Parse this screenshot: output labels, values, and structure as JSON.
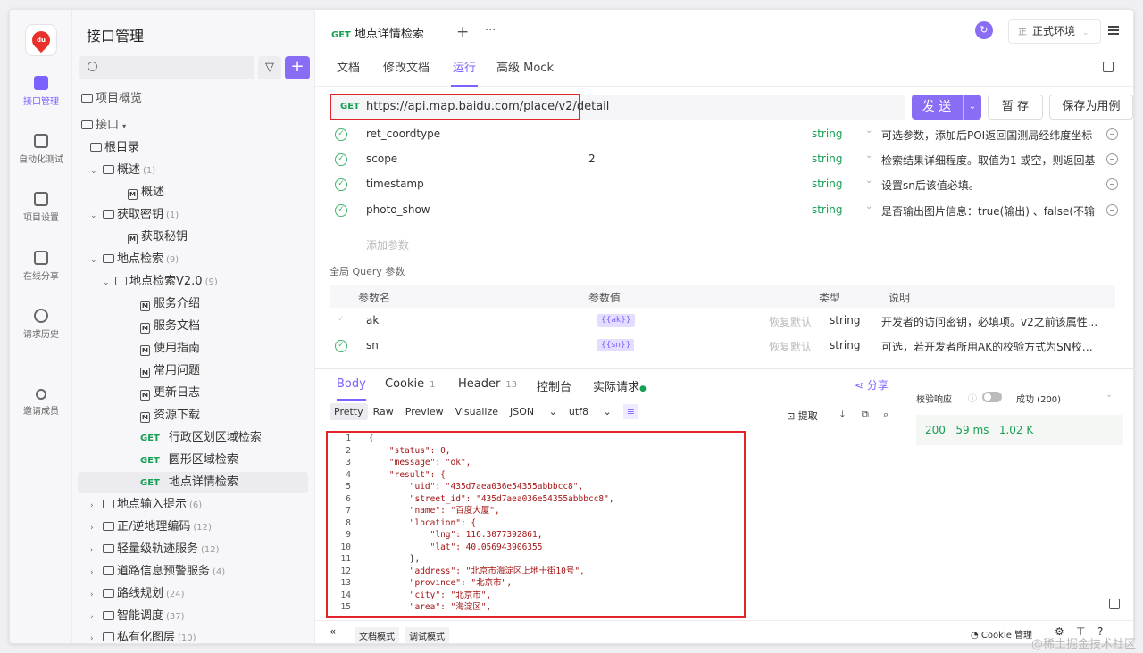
{
  "rail": {
    "items": [
      {
        "label": "接口管理",
        "icon": "api-icon"
      },
      {
        "label": "自动化测试",
        "icon": "automation-icon"
      },
      {
        "label": "项目设置",
        "icon": "settings-icon"
      },
      {
        "label": "在线分享",
        "icon": "share-doc-icon"
      },
      {
        "label": "请求历史",
        "icon": "history-icon"
      },
      {
        "label": "邀请成员",
        "icon": "invite-icon"
      }
    ],
    "logo_text": "du"
  },
  "sidebar": {
    "title": "接口管理",
    "overview": "项目概览",
    "api_root": "接口",
    "nodes": [
      {
        "label": "根目录",
        "count": ""
      },
      {
        "label": "概述",
        "count": "(1)"
      },
      {
        "label": "概述",
        "count": ""
      },
      {
        "label": "获取密钥",
        "count": "(1)"
      },
      {
        "label": "获取秘钥",
        "count": ""
      },
      {
        "label": "地点检索",
        "count": "(9)"
      },
      {
        "label": "地点检索V2.0",
        "count": "(9)"
      },
      {
        "label": "服务介绍",
        "count": ""
      },
      {
        "label": "服务文档",
        "count": ""
      },
      {
        "label": "使用指南",
        "count": ""
      },
      {
        "label": "常用问题",
        "count": ""
      },
      {
        "label": "更新日志",
        "count": ""
      },
      {
        "label": "资源下载",
        "count": ""
      },
      {
        "label": "行政区划区域检索",
        "count": "",
        "method": "GET"
      },
      {
        "label": "圆形区域检索",
        "count": "",
        "method": "GET"
      },
      {
        "label": "地点详情检索",
        "count": "",
        "method": "GET"
      },
      {
        "label": "地点输入提示",
        "count": "(6)"
      },
      {
        "label": "正/逆地理编码",
        "count": "(12)"
      },
      {
        "label": "轻量级轨迹服务",
        "count": "(12)"
      },
      {
        "label": "道路信息预警服务",
        "count": "(4)"
      },
      {
        "label": "路线规划",
        "count": "(24)"
      },
      {
        "label": "智能调度",
        "count": "(37)"
      },
      {
        "label": "私有化图层",
        "count": "(10)"
      }
    ]
  },
  "header": {
    "tab_method": "GET",
    "tab_title": "地点详情检索",
    "plus": "+",
    "more": "···",
    "env_badge": "正",
    "env": "正式环境"
  },
  "subtabs": [
    "文档",
    "修改文档",
    "运行",
    "高级 Mock"
  ],
  "url": {
    "method": "GET",
    "value": "https://api.map.baidu.com/place/v2/detail"
  },
  "buttons": {
    "send": "发 送",
    "save_temp": "暂 存",
    "save_case": "保存为用例"
  },
  "params": [
    {
      "name": "ret_coordtype",
      "value": "",
      "type": "string",
      "desc": "可选参数，添加后POI返回国测局经纬度坐标"
    },
    {
      "name": "scope",
      "value": "2",
      "type": "string",
      "desc": "检索结果详细程度。取值为1 或空，则返回基"
    },
    {
      "name": "timestamp",
      "value": "",
      "type": "string",
      "desc": "设置sn后该值必填。"
    },
    {
      "name": "photo_show",
      "value": "",
      "type": "string",
      "desc": "是否输出图片信息：true(输出) 、false(不输"
    }
  ],
  "add_param": "添加参数",
  "global_query": {
    "title": "全局 Query 参数",
    "headers": [
      "参数名",
      "参数值",
      "类型",
      "说明"
    ],
    "rows": [
      {
        "name": "ak",
        "value": "{{ak}}",
        "reset": "恢复默认",
        "type": "string",
        "desc": "开发者的访问密钥，必填项。v2之前该属性..."
      },
      {
        "name": "sn",
        "value": "{{sn}}",
        "reset": "恢复默认",
        "type": "string",
        "desc": "可选，若开发者所用AK的校验方式为SN校验..."
      }
    ]
  },
  "response": {
    "tabs": [
      {
        "label": "Body",
        "count": ""
      },
      {
        "label": "Cookie",
        "count": "1"
      },
      {
        "label": "Header",
        "count": "13"
      },
      {
        "label": "控制台",
        "count": ""
      },
      {
        "label": "实际请求",
        "count": ""
      }
    ],
    "share": "分享",
    "formats": [
      "Pretty",
      "Raw",
      "Preview",
      "Visualize"
    ],
    "format": "JSON",
    "encoding": "utf8",
    "extract": "提取",
    "validate_label": "校验响应",
    "status": "成功 (200)",
    "code": "200",
    "time": "59 ms",
    "size": "1.02 K"
  },
  "code_lines": [
    {
      "n": "1",
      "t": "{"
    },
    {
      "n": "2",
      "t": "    \"status\": 0,"
    },
    {
      "n": "3",
      "t": "    \"message\": \"ok\","
    },
    {
      "n": "4",
      "t": "    \"result\": {"
    },
    {
      "n": "5",
      "t": "        \"uid\": \"435d7aea036e54355abbbcc8\","
    },
    {
      "n": "6",
      "t": "        \"street_id\": \"435d7aea036e54355abbbcc8\","
    },
    {
      "n": "7",
      "t": "        \"name\": \"百度大厦\","
    },
    {
      "n": "8",
      "t": "        \"location\": {"
    },
    {
      "n": "9",
      "t": "            \"lng\": 116.3077392861,"
    },
    {
      "n": "10",
      "t": "            \"lat\": 40.056943906355"
    },
    {
      "n": "11",
      "t": "        },"
    },
    {
      "n": "12",
      "t": "        \"address\": \"北京市海淀区上地十街10号\","
    },
    {
      "n": "13",
      "t": "        \"province\": \"北京市\","
    },
    {
      "n": "14",
      "t": "        \"city\": \"北京市\","
    },
    {
      "n": "15",
      "t": "        \"area\": \"海淀区\","
    }
  ],
  "bottom": {
    "doc_mode": "文档模式",
    "debug_mode": "调试模式",
    "cookie": "Cookie 管理",
    "watermark": "@稀土掘金技术社区"
  }
}
